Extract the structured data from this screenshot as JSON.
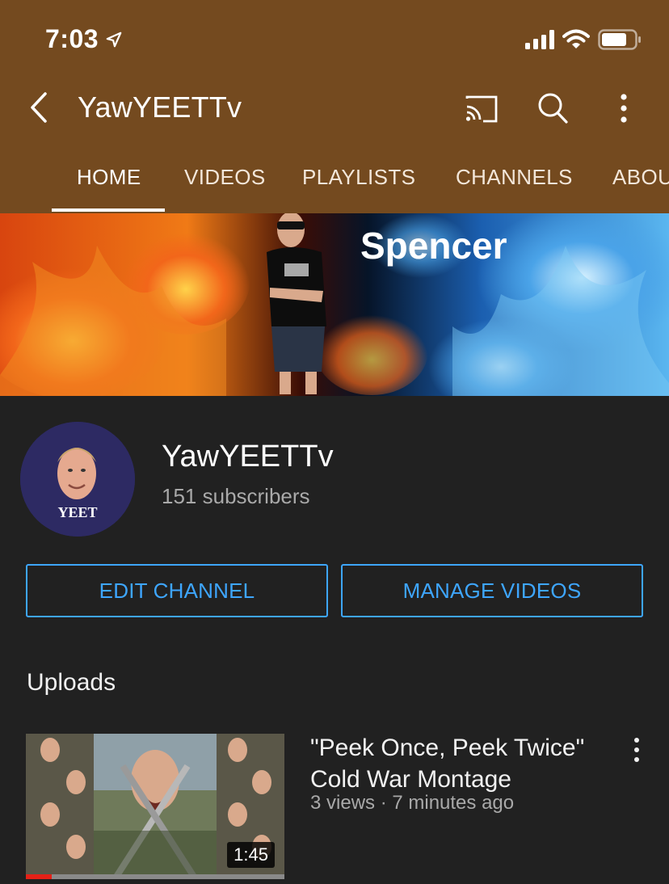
{
  "status_bar": {
    "time": "7:03"
  },
  "header": {
    "channel_title": "YawYEETTv"
  },
  "tabs": [
    {
      "label": "HOME",
      "active": true
    },
    {
      "label": "VIDEOS",
      "active": false
    },
    {
      "label": "PLAYLISTS",
      "active": false
    },
    {
      "label": "CHANNELS",
      "active": false
    },
    {
      "label": "ABOUT",
      "active": false
    }
  ],
  "banner": {
    "text": "Spencer"
  },
  "channel": {
    "avatar_text": "YEET",
    "name": "YawYEETTv",
    "subscribers": "151 subscribers"
  },
  "actions": {
    "edit_label": "EDIT CHANNEL",
    "manage_label": "MANAGE VIDEOS"
  },
  "uploads": {
    "title": "Uploads",
    "videos": [
      {
        "title": "\"Peek Once, Peek Twice\" Cold War Montage",
        "meta": "3 views · 7 minutes ago",
        "duration": "1:45",
        "progress": 0.1
      }
    ]
  },
  "icons": {
    "back": "chevron-left-icon",
    "cast": "cast-icon",
    "search": "search-icon",
    "more": "more-vertical-icon"
  },
  "colors": {
    "header_bg": "#744a1f",
    "page_bg": "#212121",
    "accent_blue": "#3ea6ff",
    "progress_red": "#e62117"
  }
}
